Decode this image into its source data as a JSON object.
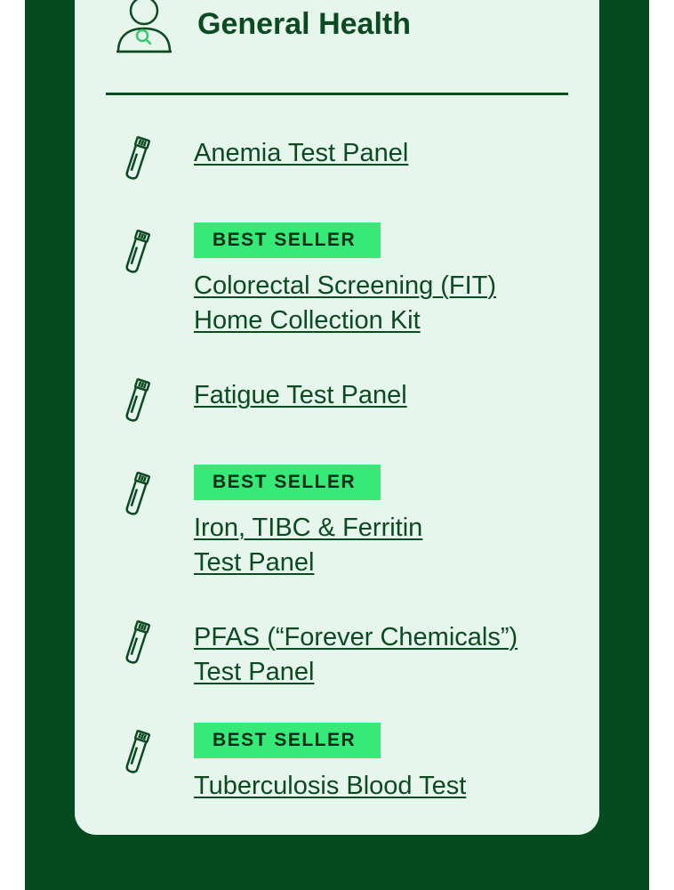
{
  "section": {
    "title": "General Health",
    "icon": "person-search-icon"
  },
  "colors": {
    "frame": "#044b1f",
    "card": "#e6f6ec",
    "text": "#0c4a22",
    "badge": "#37ea78"
  },
  "items": [
    {
      "icon": "test-tube-icon",
      "badge": "",
      "lines": [
        "Anemia Test Panel"
      ]
    },
    {
      "icon": "test-tube-icon",
      "badge": "BEST SELLER",
      "lines": [
        "Colorectal Screening (FIT)",
        "Home Collection Kit"
      ]
    },
    {
      "icon": "test-tube-icon",
      "badge": "",
      "lines": [
        "Fatigue Test Panel"
      ]
    },
    {
      "icon": "test-tube-icon",
      "badge": "BEST SELLER",
      "lines": [
        "Iron, TIBC & Ferritin",
        "Test Panel"
      ]
    },
    {
      "icon": "test-tube-icon",
      "badge": "",
      "lines": [
        "PFAS (“Forever Chemicals”)",
        "Test Panel"
      ]
    },
    {
      "icon": "test-tube-icon",
      "badge": "BEST SELLER",
      "lines": [
        "Tuberculosis Blood Test"
      ]
    }
  ]
}
